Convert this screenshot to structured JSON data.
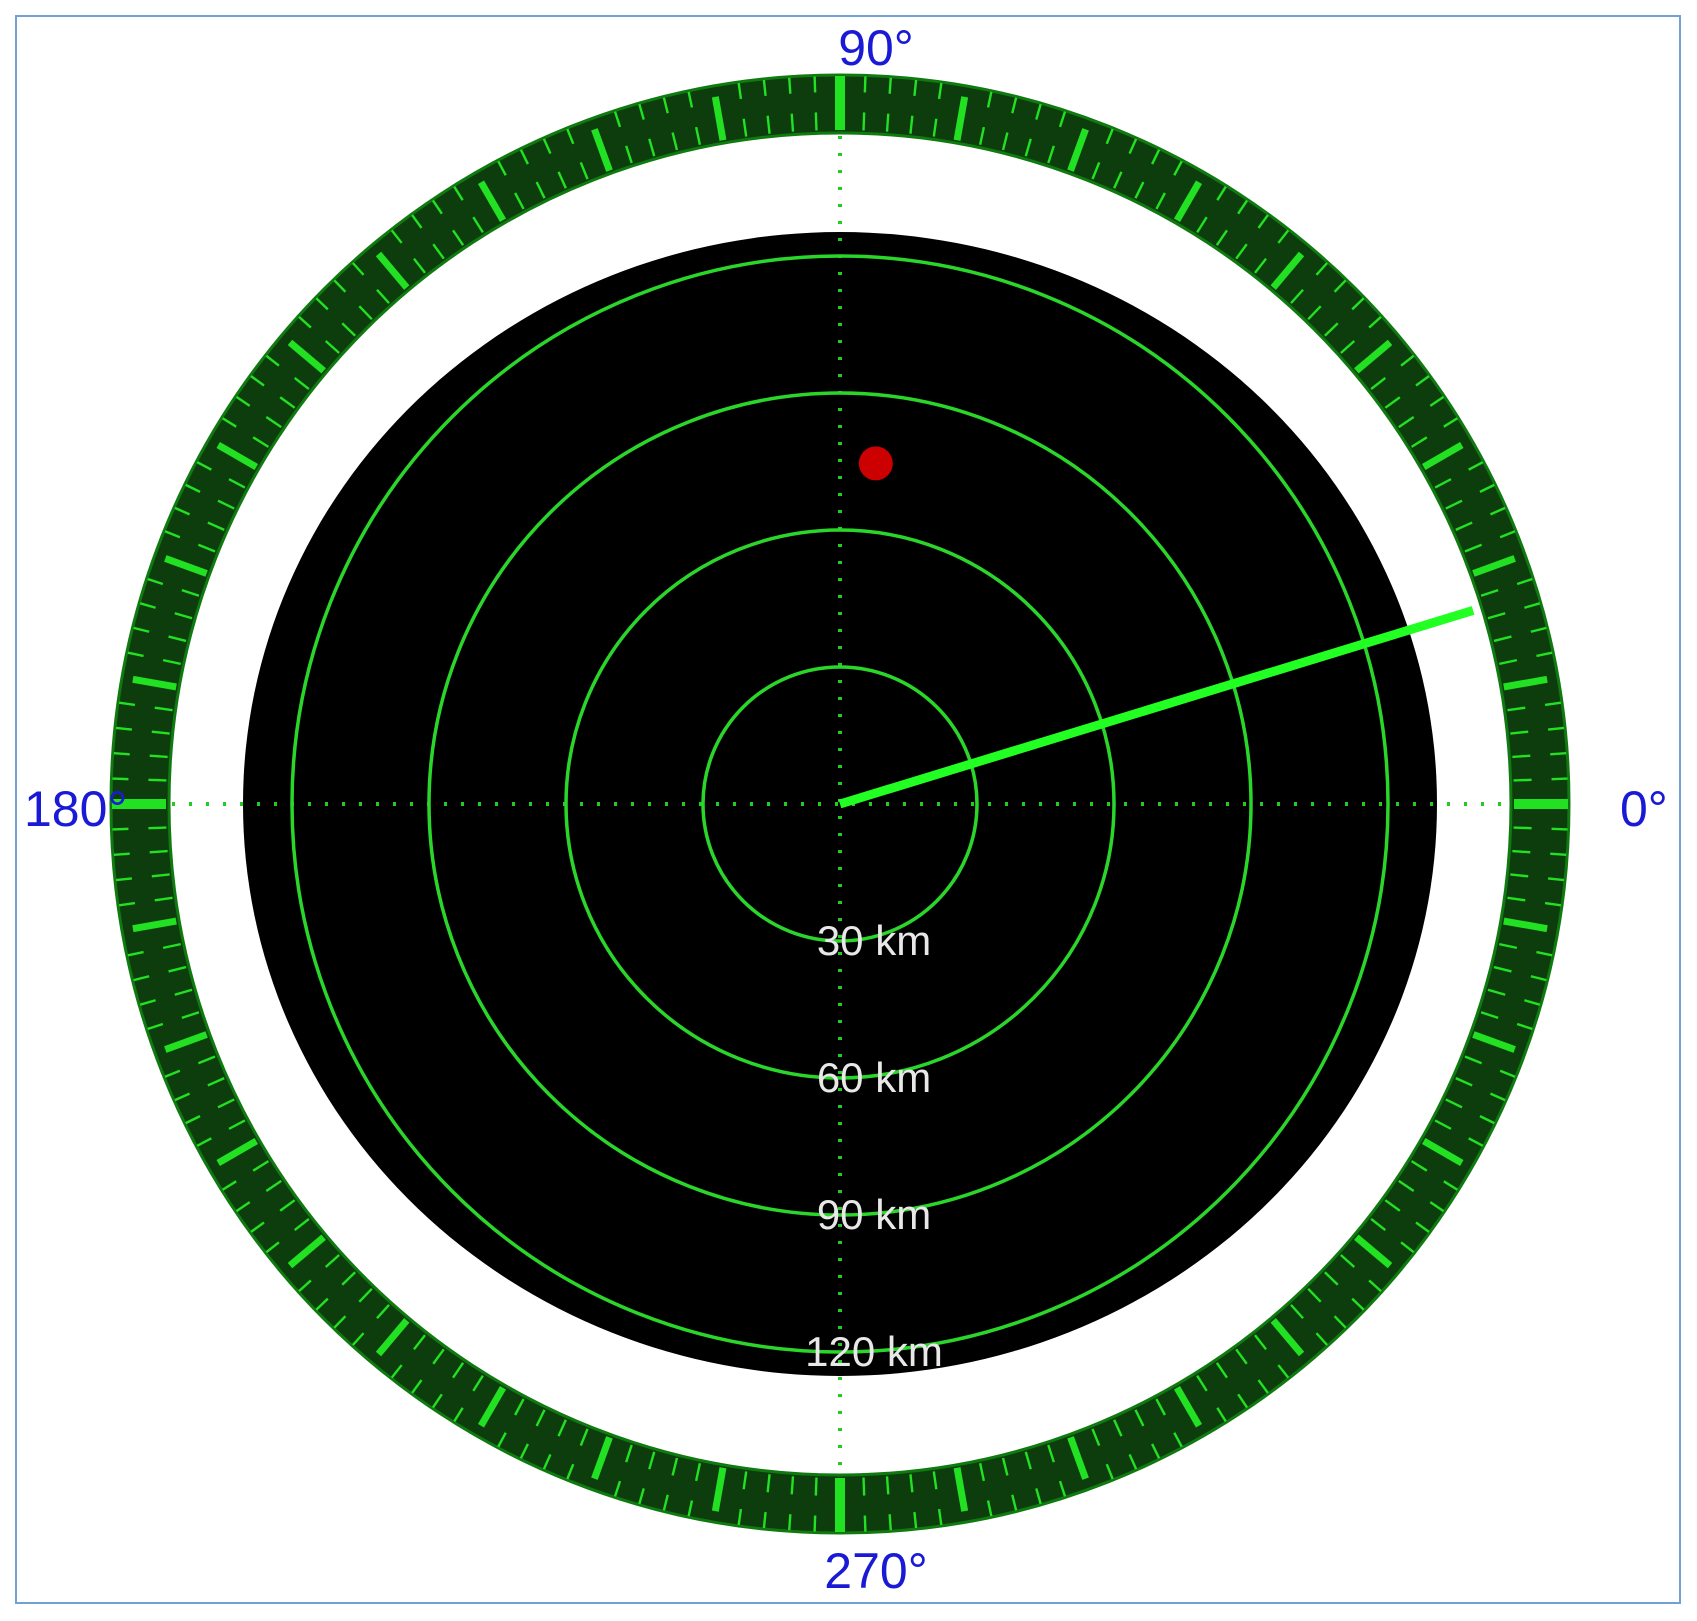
{
  "radar": {
    "bearing_labels": [
      "0°",
      "90°",
      "180°",
      "270°"
    ],
    "range_rings": [
      {
        "range_km": 30,
        "label": "30 km"
      },
      {
        "range_km": 60,
        "label": "60 km"
      },
      {
        "range_km": 90,
        "label": "90 km"
      },
      {
        "range_km": 120,
        "label": "120 km"
      }
    ],
    "max_range_km": 125,
    "sweep_bearing_deg": 17,
    "sweep_extent": "reaches inner edge of bezel",
    "target": {
      "bearing_deg": 84,
      "range_km": 75,
      "color": "#cc0000"
    },
    "bezel": {
      "minor_tick_step_deg": 2,
      "major_tick_step_deg": 10,
      "cardinal_step_deg": 90
    },
    "colors": {
      "scope_background": "#000000",
      "ring": "#2bd62b",
      "sweep": "#22ff22",
      "crosshair": "#22cc22",
      "bezel_outer": "#0f7a0f",
      "bezel_dark": "#0d3d0d",
      "bezel_tick": "#22e022",
      "bearing_text": "#1a1ad6",
      "range_text": "#e8e8e8",
      "frame_border": "#6fa3d6"
    }
  }
}
